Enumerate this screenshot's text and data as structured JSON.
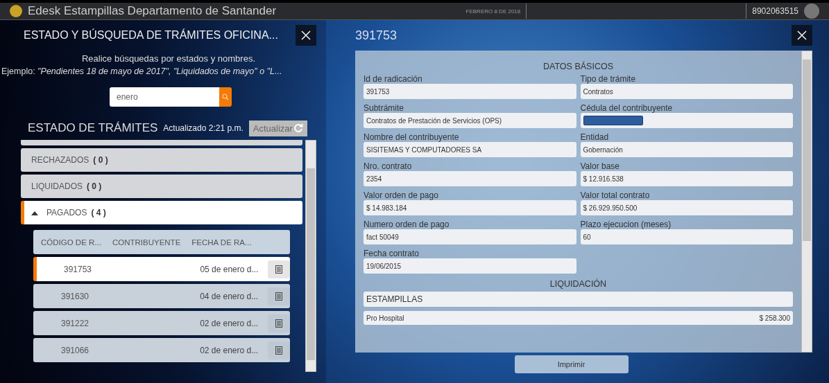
{
  "header": {
    "title": "Edesk Estampillas Departamento de Santander",
    "date": "FEBRERO 8 DE 2018",
    "account": "8902063515"
  },
  "left_panel": {
    "title": "ESTADO Y BÚSQUEDA DE TRÁMITES OFICINA...",
    "hint": "Realice búsquedas por estados y nombres.",
    "example": "Ejemplo: *\"Pendientes 18 de mayo de 2017\", \"Liquidados de mayo\" o \"L...*",
    "search": {
      "value": "enero"
    },
    "status": {
      "title": "ESTADO DE TRÁMITES",
      "updated": "Actualizado 2:21 p.m.",
      "refresh_button": "Actualizar"
    },
    "groups": [
      {
        "label": "RECHAZADOS",
        "count": "( 0 )",
        "expanded": false
      },
      {
        "label": "LIQUIDADOS",
        "count": "( 0 )",
        "expanded": false
      },
      {
        "label": "PAGADOS",
        "count": "( 4 )",
        "expanded": true,
        "columns": [
          "CÓDIGO DE R...",
          "CONTRIBUYENTE",
          "FECHA DE RA..."
        ],
        "rows": [
          {
            "code": "391753",
            "date": "05 de enero d...",
            "selected": true
          },
          {
            "code": "391630",
            "date": "04 de enero d...",
            "selected": false
          },
          {
            "code": "391222",
            "date": "02 de enero d...",
            "selected": false
          },
          {
            "code": "391066",
            "date": "02 de enero d...",
            "selected": false
          }
        ]
      }
    ]
  },
  "detail": {
    "title": "391753",
    "basic_heading": "DATOS BÁSICOS",
    "fields": [
      {
        "label": "Id de radicación",
        "value": "391753",
        "kind": "text"
      },
      {
        "label": "Tipo de trámite",
        "value": "Contratos",
        "kind": "text"
      },
      {
        "label": "Subtrámite",
        "value": "Contratos de Prestación de Servicios (OPS)",
        "kind": "text"
      },
      {
        "label": "Cédula del contribuyente",
        "kind": "redacted"
      },
      {
        "label": "Nombre del contribuyente",
        "value": "SISITEMAS Y COMPUTADORES SA",
        "kind": "text"
      },
      {
        "label": "Entidad",
        "value": "Gobernación",
        "kind": "text"
      },
      {
        "label": "Nro. contrato",
        "value": "2354",
        "kind": "text"
      },
      {
        "label": "Valor base",
        "value": "$ 12.916.538",
        "kind": "text"
      },
      {
        "label": "Valor orden de pago",
        "value": "$ 14.983.184",
        "kind": "text"
      },
      {
        "label": "Valor total contrato",
        "value": "$ 26.929.950.500",
        "kind": "text"
      },
      {
        "label": "Numero orden de pago",
        "value": "fact 50049",
        "kind": "text"
      },
      {
        "label": "Plazo ejecucion (meses)",
        "value": "60",
        "kind": "text"
      },
      {
        "label": "Fecha contrato",
        "value": "19/06/2015",
        "kind": "text"
      }
    ],
    "liquidation_heading": "LIQUIDACIÓN",
    "liquidation_group": "ESTAMPILLAS",
    "liquidation_items": [
      {
        "name": "Pro Hospital",
        "value": "$ 258.300"
      }
    ],
    "print_button": "Imprimir"
  }
}
